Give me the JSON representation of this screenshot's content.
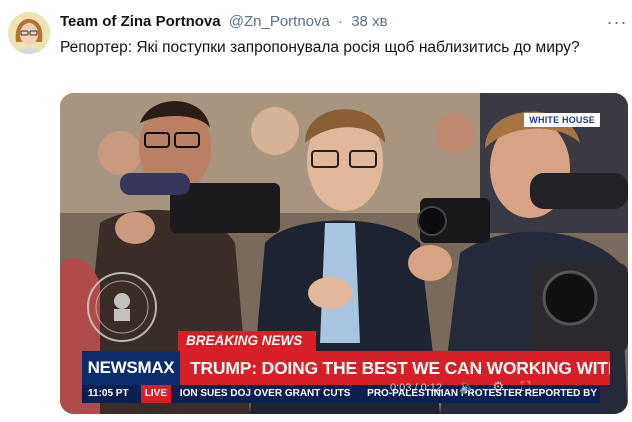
{
  "tweet": {
    "display_name": "Team of Zina Portnova",
    "handle": "@Zn_Portnova",
    "separator": "·",
    "time": "38 хв",
    "more_icon": "more-dots-icon",
    "text": "Репортер: Які поступки запропонувала росія щоб наблизитись до миру?"
  },
  "video": {
    "network_bug": "WHITE HOUSE",
    "breaking_label": "BREAKING NEWS",
    "network_logo": "NEWSMAX",
    "headline": "TRUMP: DOING THE BEST WE CAN WORKING WITH UKRAINE",
    "ticker": {
      "time": "11:05 PT",
      "live": "LIVE",
      "item_1": "ION SUES DOJ OVER GRANT CUTS",
      "item_2": "PRO-PALESTINIAN PROTESTER REPORTED BY FEDERAL"
    },
    "player": {
      "elapsed": "0:03",
      "duration": "0:12",
      "divider": "/",
      "icons": [
        "volume-icon",
        "settings-gear-icon",
        "fullscreen-icon"
      ]
    },
    "colors": {
      "breaking_red": "#d61f26",
      "newsmax_blue": "#0a2d6b",
      "ticker_navy": "#0a2050"
    }
  }
}
